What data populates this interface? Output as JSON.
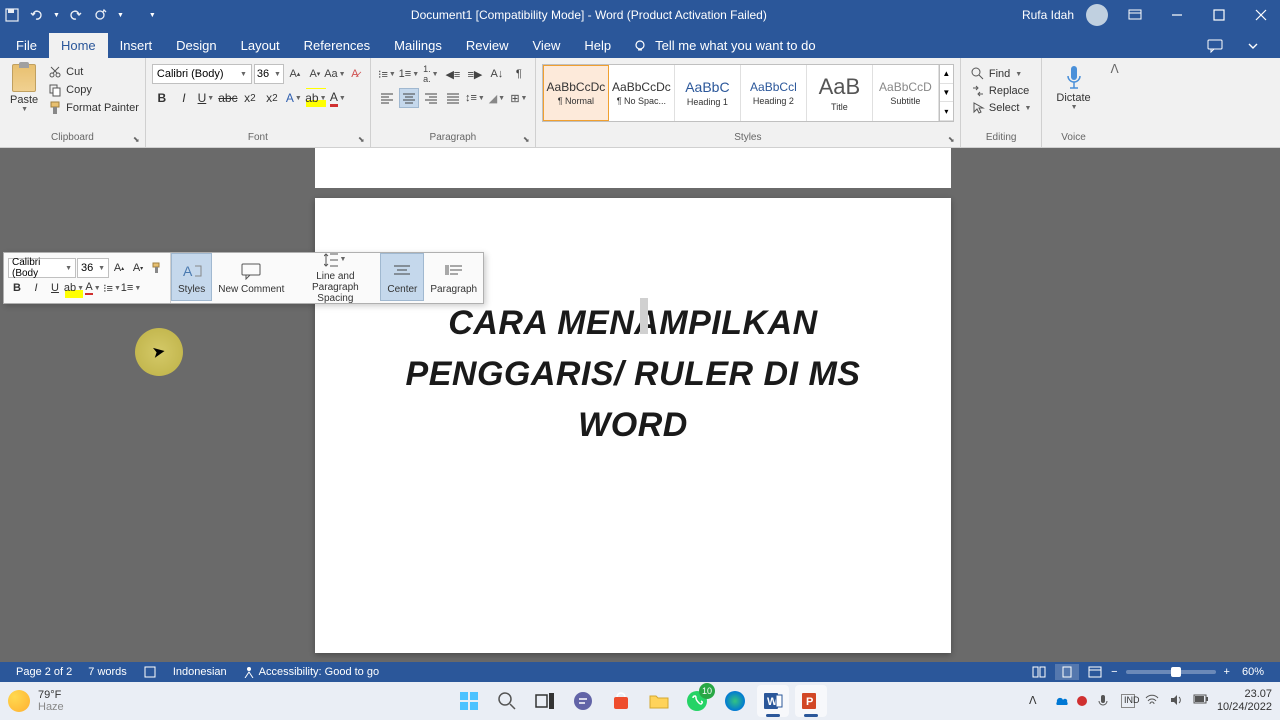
{
  "titlebar": {
    "title": "Document1 [Compatibility Mode]  -  Word (Product Activation Failed)",
    "user": "Rufa Idah"
  },
  "tabs": {
    "file": "File",
    "home": "Home",
    "insert": "Insert",
    "design": "Design",
    "layout": "Layout",
    "references": "References",
    "mailings": "Mailings",
    "review": "Review",
    "view": "View",
    "help": "Help",
    "tellme": "Tell me what you want to do"
  },
  "ribbon": {
    "clipboard": {
      "label": "Clipboard",
      "paste": "Paste",
      "cut": "Cut",
      "copy": "Copy",
      "painter": "Format Painter"
    },
    "font": {
      "label": "Font",
      "name": "Calibri (Body)",
      "size": "36"
    },
    "paragraph": {
      "label": "Paragraph"
    },
    "styles": {
      "label": "Styles",
      "items": [
        {
          "preview": "AaBbCcDc",
          "name": "¶ Normal"
        },
        {
          "preview": "AaBbCcDc",
          "name": "¶ No Spac..."
        },
        {
          "preview": "AaBbC",
          "name": "Heading 1"
        },
        {
          "preview": "AaBbCcl",
          "name": "Heading 2"
        },
        {
          "preview": "AaB",
          "name": "Title"
        },
        {
          "preview": "AaBbCcD",
          "name": "Subtitle"
        }
      ]
    },
    "editing": {
      "label": "Editing",
      "find": "Find",
      "replace": "Replace",
      "select": "Select"
    },
    "voice": {
      "label": "Voice",
      "dictate": "Dictate"
    }
  },
  "document": {
    "line1": "CARA MENAMPILKAN",
    "line2": "PENGGARIS/ RULER DI MS WORD"
  },
  "minitoolbar": {
    "font": "Calibri (Body",
    "size": "36",
    "styles": "Styles",
    "comment": "New Comment",
    "spacing": "Line and Paragraph Spacing",
    "center": "Center",
    "paragraph": "Paragraph"
  },
  "statusbar": {
    "page": "Page 2 of 2",
    "words": "7 words",
    "lang": "Indonesian",
    "access": "Accessibility: Good to go",
    "zoom": "60%"
  },
  "taskbar": {
    "temp": "79°F",
    "cond": "Haze",
    "badge": "10",
    "time": "23.07",
    "date": "10/24/2022"
  }
}
